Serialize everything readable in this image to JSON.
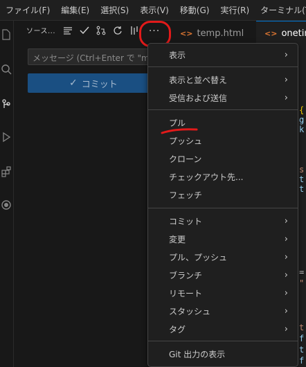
{
  "menubar": {
    "items": [
      "ファイル(F)",
      "編集(E)",
      "選択(S)",
      "表示(V)",
      "移動(G)",
      "実行(R)",
      "ターミナル(T)"
    ]
  },
  "activity_bar": {
    "icons": [
      "explorer-icon",
      "search-icon",
      "source-control-icon",
      "run-debug-icon",
      "extensions-icon",
      "remote-icon"
    ]
  },
  "sidebar": {
    "title": "ソース...",
    "tool_icons": [
      "view-as-tree-icon",
      "commit-check-icon",
      "pull-request-icon",
      "refresh-icon",
      "graph-icon"
    ],
    "more_label": "···",
    "commit_input_placeholder": "メッセージ (Ctrl+Enter で \"m",
    "commit_button_label": "コミット"
  },
  "tabs": [
    {
      "label": "temp.html",
      "icon": "<>",
      "active": false
    },
    {
      "label": "onetime",
      "icon": "<>",
      "active": true
    }
  ],
  "context_menu": {
    "groups": [
      [
        {
          "label": "表示",
          "submenu": true
        }
      ],
      [
        {
          "label": "表示と並べ替え",
          "submenu": true
        },
        {
          "label": "受信および送信",
          "submenu": true
        }
      ],
      [
        {
          "label": "プル",
          "submenu": false
        },
        {
          "label": "プッシュ",
          "submenu": false
        },
        {
          "label": "クローン",
          "submenu": false
        },
        {
          "label": "チェックアウト先...",
          "submenu": false
        },
        {
          "label": "フェッチ",
          "submenu": false
        }
      ],
      [
        {
          "label": "コミット",
          "submenu": true
        },
        {
          "label": "変更",
          "submenu": true
        },
        {
          "label": "プル、プッシュ",
          "submenu": true
        },
        {
          "label": "ブランチ",
          "submenu": true
        },
        {
          "label": "リモート",
          "submenu": true
        },
        {
          "label": "スタッシュ",
          "submenu": true
        },
        {
          "label": "タグ",
          "submenu": true
        }
      ],
      [
        {
          "label": "Git 出力の表示",
          "submenu": false
        }
      ]
    ]
  },
  "colors": {
    "accent": "#0078d4",
    "annotation_red": "#e21a1a",
    "commit_button": "#1a4f82",
    "menu_bg": "#1f1f1f"
  }
}
